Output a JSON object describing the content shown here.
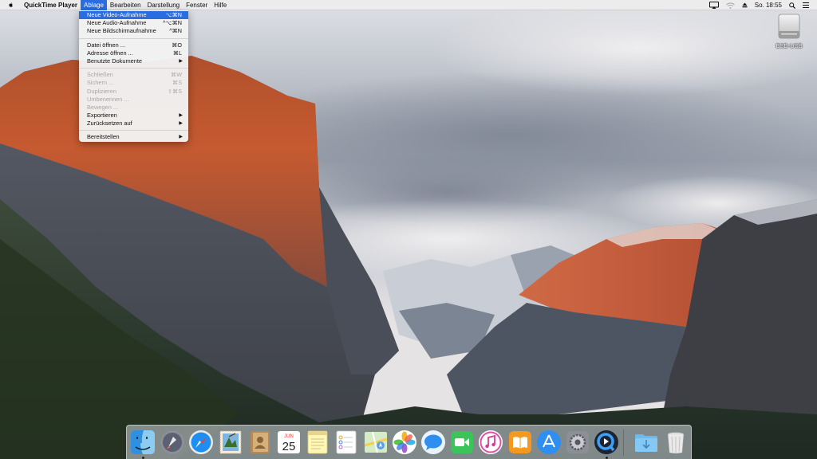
{
  "menubar": {
    "app_name": "QuickTime Player",
    "menus": [
      "Ablage",
      "Bearbeiten",
      "Darstellung",
      "Fenster",
      "Hilfe"
    ],
    "active_menu": "Ablage",
    "clock": "So. 18:55"
  },
  "file_menu": {
    "items": [
      {
        "label": "Neue Video-Aufnahme",
        "shortcut": "⌥⌘N",
        "state": "highlighted"
      },
      {
        "label": "Neue Audio-Aufnahme",
        "shortcut": "^⌥⌘N",
        "state": "enabled"
      },
      {
        "label": "Neue Bildschirmaufnahme",
        "shortcut": "^⌘N",
        "state": "enabled"
      },
      {
        "label": "Datei öffnen ...",
        "shortcut": "⌘O",
        "state": "enabled"
      },
      {
        "label": "Adresse öffnen ...",
        "shortcut": "⌘L",
        "state": "enabled"
      },
      {
        "label": "Benutzte Dokumente",
        "shortcut": "",
        "state": "submenu"
      },
      {
        "label": "Schließen",
        "shortcut": "⌘W",
        "state": "disabled"
      },
      {
        "label": "Sichern ...",
        "shortcut": "⌘S",
        "state": "disabled"
      },
      {
        "label": "Duplizieren",
        "shortcut": "⇧⌘S",
        "state": "disabled"
      },
      {
        "label": "Umbenennen ...",
        "shortcut": "",
        "state": "disabled"
      },
      {
        "label": "Bewegen ...",
        "shortcut": "",
        "state": "disabled"
      },
      {
        "label": "Exportieren",
        "shortcut": "",
        "state": "submenu"
      },
      {
        "label": "Zurücksetzen auf",
        "shortcut": "",
        "state": "submenu"
      },
      {
        "label": "Bereitstellen",
        "shortcut": "",
        "state": "submenu"
      }
    ]
  },
  "desktop": {
    "drive_label": "ESD-USB"
  },
  "dock": {
    "apps": [
      {
        "icon": "finder-icon",
        "running": true
      },
      {
        "icon": "launchpad-icon",
        "running": false
      },
      {
        "icon": "safari-icon",
        "running": false
      },
      {
        "icon": "mail-icon",
        "running": false
      },
      {
        "icon": "contacts-icon",
        "running": false
      },
      {
        "icon": "calendar-icon",
        "running": false,
        "month": "JUN",
        "day": "25"
      },
      {
        "icon": "notes-icon",
        "running": false
      },
      {
        "icon": "reminders-icon",
        "running": false
      },
      {
        "icon": "maps-icon",
        "running": false
      },
      {
        "icon": "photos-icon",
        "running": false
      },
      {
        "icon": "messages-icon",
        "running": false
      },
      {
        "icon": "facetime-icon",
        "running": false
      },
      {
        "icon": "itunes-icon",
        "running": false
      },
      {
        "icon": "ibooks-icon",
        "running": false
      },
      {
        "icon": "app-store-icon",
        "running": false
      },
      {
        "icon": "system-preferences-icon",
        "running": false
      },
      {
        "icon": "quicktime-icon",
        "running": true
      },
      {
        "icon": "downloads-folder-icon",
        "running": false
      },
      {
        "icon": "trash-icon",
        "running": false
      }
    ]
  },
  "colors": {
    "menu_highlight": "#2a6de0",
    "menubar_bg": "#ececec"
  }
}
